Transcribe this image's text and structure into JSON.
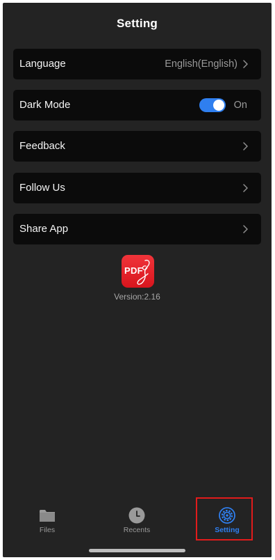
{
  "header": {
    "title": "Setting"
  },
  "settings": {
    "language": {
      "label": "Language",
      "value": "English(English)"
    },
    "dark_mode": {
      "label": "Dark Mode",
      "enabled": true,
      "state_text": "On"
    },
    "feedback": {
      "label": "Feedback"
    },
    "follow_us": {
      "label": "Follow Us"
    },
    "share_app": {
      "label": "Share App"
    }
  },
  "app": {
    "logo_text": "PDF",
    "version": "Version:2.16"
  },
  "tabbar": {
    "tabs": [
      {
        "label": "Files",
        "icon": "folder-icon",
        "active": false
      },
      {
        "label": "Recents",
        "icon": "clock-icon",
        "active": false
      },
      {
        "label": "Setting",
        "icon": "gear-icon",
        "active": true
      }
    ]
  },
  "colors": {
    "background": "#232323",
    "row_background": "#0b0b0b",
    "accent": "#2f7fef",
    "highlight": "#e11b1b"
  }
}
